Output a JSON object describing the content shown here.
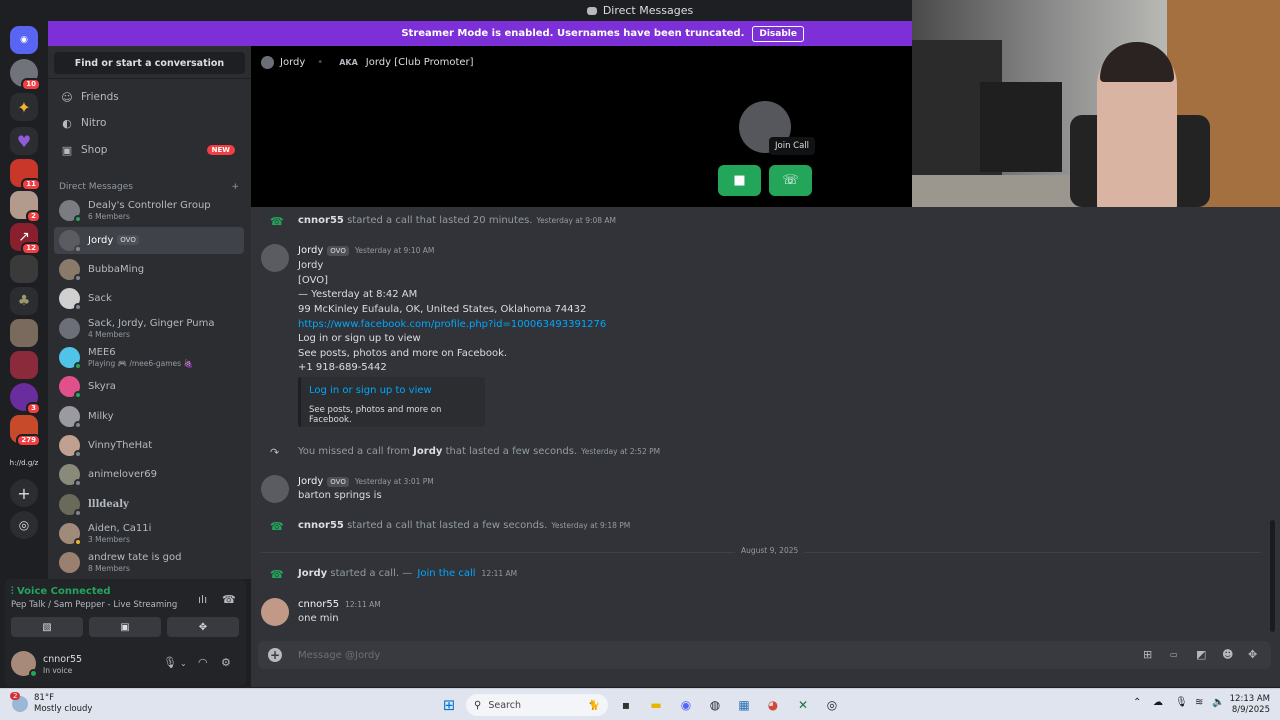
{
  "window": {
    "title": "Direct Messages"
  },
  "banner": {
    "text": "Streamer Mode is enabled. Usernames have been truncated.",
    "disable_label": "Disable"
  },
  "servers": [
    {
      "badge": "10"
    },
    {
      "badge": ""
    },
    {
      "badge": ""
    },
    {
      "badge": "11"
    },
    {
      "badge": "2"
    },
    {
      "badge": "12"
    },
    {
      "badge": ""
    },
    {
      "badge": ""
    },
    {
      "badge": ""
    },
    {
      "badge": ""
    },
    {
      "badge": "3"
    },
    {
      "badge": "279"
    }
  ],
  "server_text": "h://d.g/z",
  "sidebar": {
    "search_label": "Find or start a conversation",
    "nav": [
      {
        "label": "Friends",
        "icon": "friends-icon"
      },
      {
        "label": "Nitro",
        "icon": "nitro-icon"
      },
      {
        "label": "Shop",
        "icon": "shop-icon",
        "badge": "NEW"
      }
    ],
    "dm_header": "Direct Messages",
    "dms": [
      {
        "name": "Dealy's Controller Group",
        "sub": "6 Members"
      },
      {
        "name": "Jordy",
        "tag": "OVO",
        "sub": ""
      },
      {
        "name": "BubbaMing",
        "sub": ""
      },
      {
        "name": "Sack",
        "sub": ""
      },
      {
        "name": "Sack, Jordy, Ginger Puma",
        "sub": "4 Members"
      },
      {
        "name": "MEE6",
        "sub": "Playing 🎮 /mee6-games 🍇"
      },
      {
        "name": "Skyra",
        "sub": ""
      },
      {
        "name": "Milky",
        "sub": ""
      },
      {
        "name": "VinnyTheHat",
        "sub": ""
      },
      {
        "name": "animelover69",
        "sub": ""
      },
      {
        "name": "llldealy",
        "sub": ""
      },
      {
        "name": "Aiden, Ca11i",
        "sub": "3 Members"
      },
      {
        "name": "andrew tate is god",
        "sub": "8 Members"
      }
    ]
  },
  "voice": {
    "title": "Voice Connected",
    "channel": "Pep Talk / Sam Pepper - Live Streaming",
    "user": "cnnor55",
    "user_status": "In voice"
  },
  "call": {
    "name": "Jordy",
    "aka_label": "AKA",
    "aka": "Jordy [Club Promoter]",
    "tooltip": "Join Call"
  },
  "chat": {
    "sys1": {
      "user": "cnnor55",
      "text": "started a call that lasted 20 minutes.",
      "ts": "Yesterday at 9:08 AM"
    },
    "msg1": {
      "author": "Jordy",
      "tag": "OVO",
      "ts": "Yesterday at 9:10 AM",
      "lines": [
        "Jordy",
        "[OVO]",
        "— Yesterday at 8:42 AM",
        "99 McKinley Eufaula, OK, United States, Oklahoma 74432"
      ],
      "link": "https://www.facebook.com/profile.php?id=100063493391276",
      "lines2": [
        "Log in or sign up to view",
        "See posts, photos and more on Facebook.",
        "+1 918-689-5442"
      ],
      "embed_title": "Log in or sign up to view",
      "embed_desc": "See posts, photos and more on Facebook."
    },
    "sys2": {
      "pre": "You missed a call from",
      "user": "Jordy",
      "text": "that lasted a few seconds.",
      "ts": "Yesterday at 2:52 PM"
    },
    "msg2": {
      "author": "Jordy",
      "tag": "OVO",
      "ts": "Yesterday at 3:01 PM",
      "text": "barton springs is"
    },
    "sys3": {
      "user": "cnnor55",
      "text": "started a call that lasted a few seconds.",
      "ts": "Yesterday at 9:18 PM"
    },
    "date_divider": "August 9, 2025",
    "sys4": {
      "user": "Jordy",
      "text": "started a call. —",
      "link": "Join the call",
      "ts": "12:11 AM"
    },
    "msg3": {
      "author": "cnnor55",
      "ts": "12:11 AM",
      "text": "one min"
    }
  },
  "input": {
    "placeholder": "Message @Jordy"
  },
  "taskbar": {
    "weather_badge": "2",
    "temp": "81°F",
    "condition": "Mostly cloudy",
    "search_label": "Search",
    "time": "12:13 AM",
    "date": "8/9/2025"
  }
}
